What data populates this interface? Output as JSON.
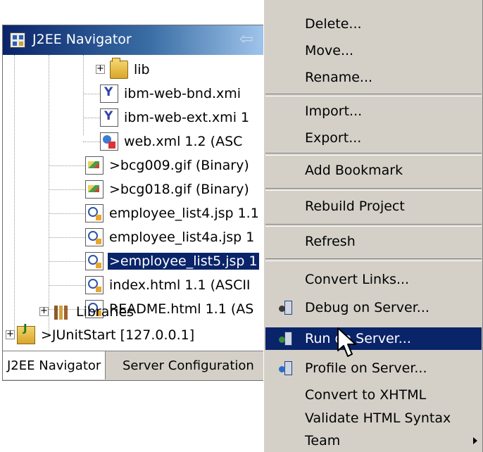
{
  "navigator": {
    "title": "J2EE Navigator",
    "tree": [
      {
        "label": "lib",
        "icon": "folder-icon"
      },
      {
        "label": "ibm-web-bnd.xmi",
        "icon": "xmi-file-icon"
      },
      {
        "label": "ibm-web-ext.xmi  1",
        "icon": "xmi-file-icon"
      },
      {
        "label": "web.xml  1.2  (ASC",
        "icon": "xml-file-icon"
      },
      {
        "label": ">bcg009.gif   (Binary)",
        "icon": "gif-file-icon"
      },
      {
        "label": ">bcg018.gif   (Binary)",
        "icon": "gif-file-icon"
      },
      {
        "label": "employee_list4.jsp  1.1",
        "icon": "jsp-file-icon"
      },
      {
        "label": "employee_list4a.jsp  1",
        "icon": "jsp-file-icon"
      },
      {
        "label": ">employee_list5.jsp  1",
        "icon": "jsp-file-icon",
        "selected": true
      },
      {
        "label": "index.html  1.1  (ASCII",
        "icon": "jsp-file-icon"
      },
      {
        "label": "README.html  1.1  (AS",
        "icon": "jsp-file-icon"
      },
      {
        "label": "Libraries",
        "icon": "libraries-icon"
      },
      {
        "label": ">JUnitStart   [127.0.0.1]",
        "icon": "project-icon"
      }
    ],
    "tabs": [
      "J2EE Navigator",
      "Server Configuration"
    ]
  },
  "menu": {
    "items": [
      {
        "label": "Delete..."
      },
      {
        "label": "Move..."
      },
      {
        "label": "Rename..."
      },
      {
        "label": "Import..."
      },
      {
        "label": "Export..."
      },
      {
        "label": "Add Bookmark"
      },
      {
        "label": "Rebuild Project"
      },
      {
        "label": "Refresh"
      },
      {
        "label": "Convert Links..."
      },
      {
        "label": "Debug on Server...",
        "icon": "debug-server-icon"
      },
      {
        "label": "Run on Server...",
        "icon": "run-server-icon",
        "highlighted": true
      },
      {
        "label": "Profile on Server...",
        "icon": "profile-server-icon"
      },
      {
        "label": "Convert to XHTML"
      },
      {
        "label": "Validate HTML Syntax"
      },
      {
        "label": "Team",
        "submenu": true
      }
    ]
  },
  "colors": {
    "selection": "#0a246a",
    "menu_background": "#d4d0c8",
    "title_gradient_start": "#0a246a",
    "title_gradient_end": "#a6caf0"
  }
}
